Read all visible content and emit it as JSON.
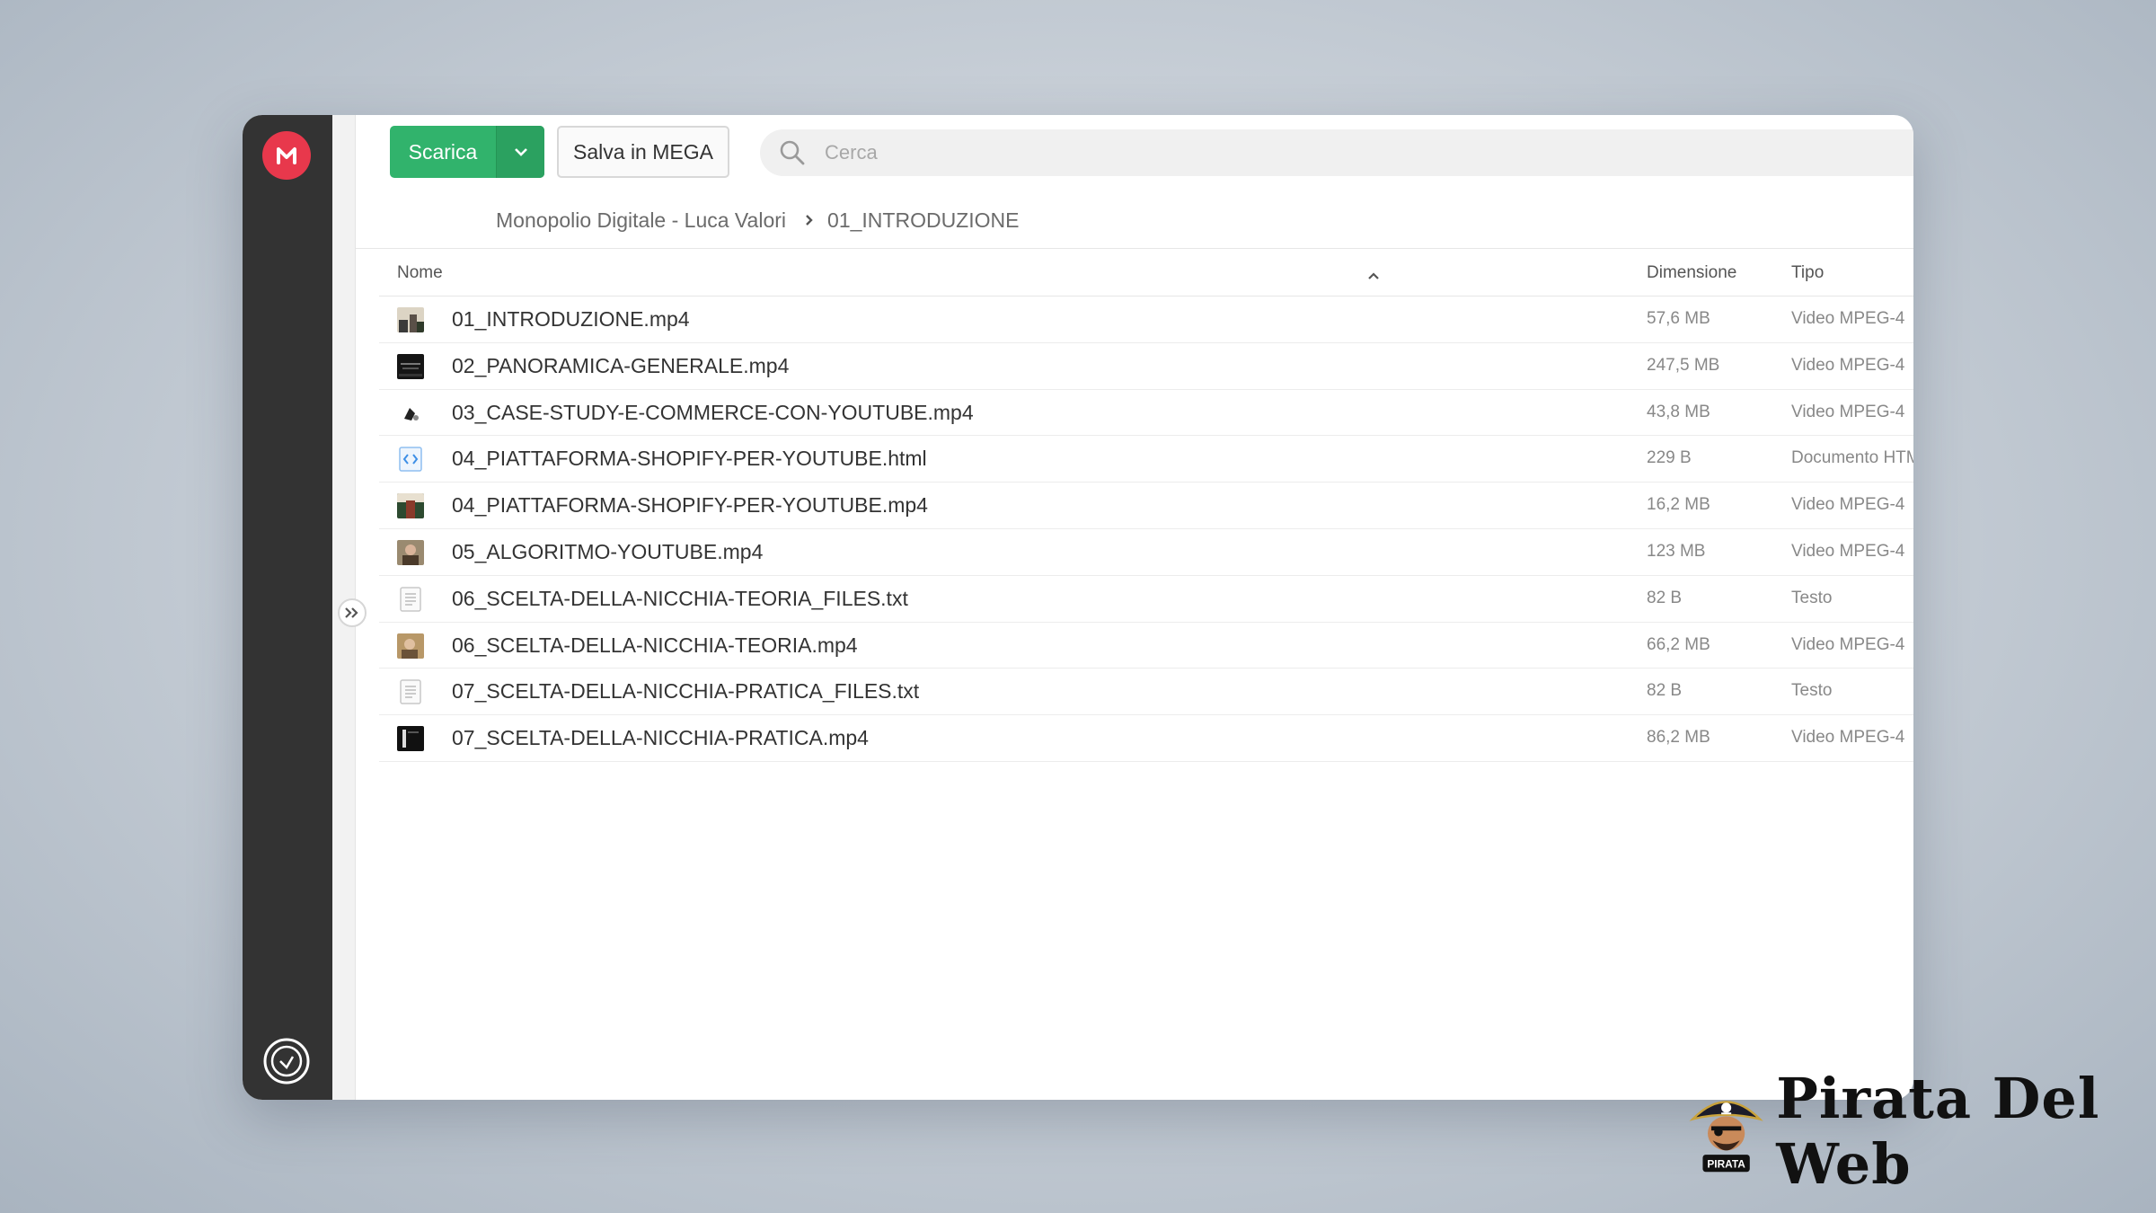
{
  "toolbar": {
    "download_label": "Scarica",
    "save_label": "Salva in MEGA",
    "search_placeholder": "Cerca"
  },
  "breadcrumb": {
    "items": [
      "Monopolio Digitale - Luca Valori",
      "01_INTRODUZIONE"
    ]
  },
  "columns": {
    "name": "Nome",
    "size": "Dimensione",
    "type": "Tipo"
  },
  "files": [
    {
      "name": "01_INTRODUZIONE.mp4",
      "size": "57,6 MB",
      "type": "Video MPEG-4",
      "icon": "video-thumbnail"
    },
    {
      "name": "02_PANORAMICA-GENERALE.mp4",
      "size": "247,5 MB",
      "type": "Video MPEG-4",
      "icon": "video-thumbnail"
    },
    {
      "name": "03_CASE-STUDY-E-COMMERCE-CON-YOUTUBE.mp4",
      "size": "43,8 MB",
      "type": "Video MPEG-4",
      "icon": "video-thumbnail"
    },
    {
      "name": "04_PIATTAFORMA-SHOPIFY-PER-YOUTUBE.html",
      "size": "229 B",
      "type": "Documento HTML",
      "icon": "html-file-icon"
    },
    {
      "name": "04_PIATTAFORMA-SHOPIFY-PER-YOUTUBE.mp4",
      "size": "16,2 MB",
      "type": "Video MPEG-4",
      "icon": "video-thumbnail"
    },
    {
      "name": "05_ALGORITMO-YOUTUBE.mp4",
      "size": "123 MB",
      "type": "Video MPEG-4",
      "icon": "video-thumbnail"
    },
    {
      "name": "06_SCELTA-DELLA-NICCHIA-TEORIA_FILES.txt",
      "size": "82 B",
      "type": "Testo",
      "icon": "text-file-icon"
    },
    {
      "name": "06_SCELTA-DELLA-NICCHIA-TEORIA.mp4",
      "size": "66,2 MB",
      "type": "Video MPEG-4",
      "icon": "video-thumbnail"
    },
    {
      "name": "07_SCELTA-DELLA-NICCHIA-PRATICA_FILES.txt",
      "size": "82 B",
      "type": "Testo",
      "icon": "text-file-icon"
    },
    {
      "name": "07_SCELTA-DELLA-NICCHIA-PRATICA.mp4",
      "size": "86,2 MB",
      "type": "Video MPEG-4",
      "icon": "video-thumbnail"
    }
  ],
  "colors": {
    "accent": "#31b36c",
    "brand": "#e8384c",
    "sidebar": "#333333"
  },
  "watermark": {
    "text": "Pirata Del Web",
    "badge": "PIRATA"
  }
}
